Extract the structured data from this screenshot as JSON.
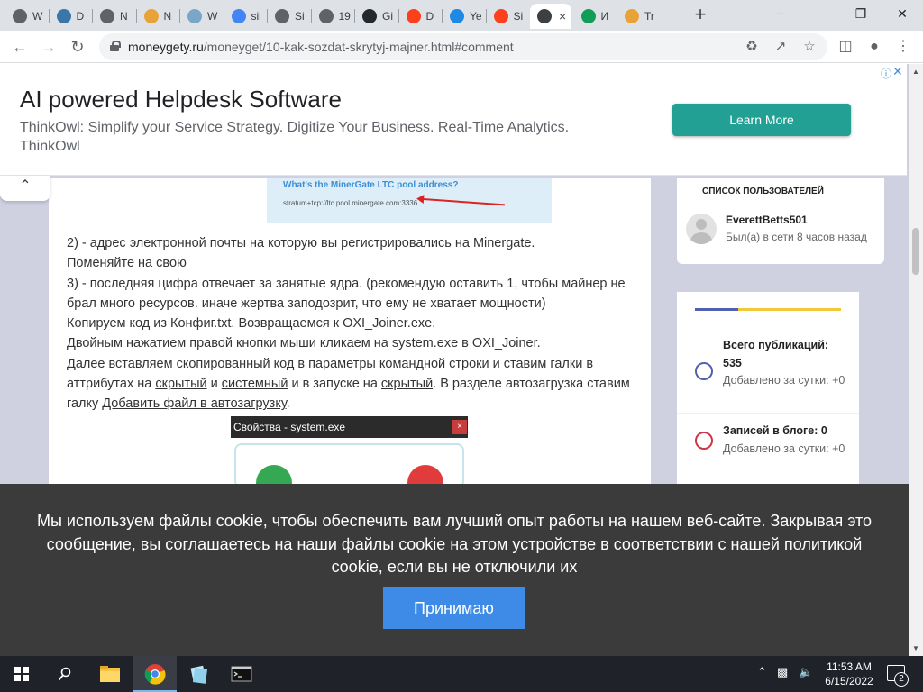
{
  "browser": {
    "tabs": [
      {
        "label": "W",
        "icon": "github-icon",
        "color": "#5f6368"
      },
      {
        "label": "D",
        "icon": "python-icon",
        "color": "#3b76a8"
      },
      {
        "label": "N",
        "icon": "github-icon",
        "color": "#5f6368"
      },
      {
        "label": "N",
        "icon": "rainbow-icon",
        "color": "#e8a23a"
      },
      {
        "label": "W",
        "icon": "web-icon",
        "color": "#7aa7c7"
      },
      {
        "label": "sil",
        "icon": "google-icon",
        "color": "#4285f4"
      },
      {
        "label": "Si",
        "icon": "globe-icon",
        "color": "#5f6368"
      },
      {
        "label": "19",
        "icon": "globe-icon",
        "color": "#5f6368"
      },
      {
        "label": "Gi",
        "icon": "github-icon",
        "color": "#24292e"
      },
      {
        "label": "D",
        "icon": "yandex-icon",
        "color": "#fc3f1d"
      },
      {
        "label": "Ye",
        "icon": "edge-icon",
        "color": "#1e88e5"
      },
      {
        "label": "Si",
        "icon": "yandex-icon",
        "color": "#fc3f1d"
      },
      {
        "label": "",
        "icon": "stack-icon",
        "color": "#3c4043",
        "active": true
      },
      {
        "label": "И",
        "icon": "drive-icon",
        "color": "#0f9d58"
      },
      {
        "label": "Tr",
        "icon": "chevron-icon",
        "color": "#e8a23a"
      }
    ],
    "url_host": "moneygety.ru",
    "url_path": "/moneyget/10-kak-sozdat-skrytyj-majner.html#comment"
  },
  "ad": {
    "title": "AI powered Helpdesk Software",
    "text": "ThinkOwl: Simplify your Service Strategy. Digitize Your Business. Real-Time Analytics. ThinkOwl",
    "button": "Learn More",
    "accent": "#23a094"
  },
  "article": {
    "image1": {
      "question": "What's the MinerGate LTC pool address?",
      "stratum": "stratum+tcp://ltc.pool.minergate.com:3336"
    },
    "lines": {
      "l1": "2) - адрес электронной почты на которую вы регистрировались на Minergate.",
      "l2": "Поменяйте на свою",
      "l3": "3) - последняя цифра отвечает за занятые ядра. (рекомендую оставить 1, чтобы майнер не брал много ресурсов. иначе жертва заподозрит, что ему не хватает мощности)",
      "l4": "Копируем код из Конфиг.txt. Возвращаемся к OXI_Joiner.exe.",
      "l5": "Двойным нажатием правой кнопки мыши кликаем на system.exe в OXI_Joiner.",
      "l6a": "Далее вставляем скопированный код в параметры командной строки и ставим галки в аттрибутах на ",
      "link_hidden1": "скрытый",
      "and": " и ",
      "link_system": "системный",
      "l6b": " и в запуске на ",
      "link_hidden2": "скрытый",
      "l6c": ". В разделе автозагрузка ставим галку ",
      "link_autostart": "Добавить файл в автозагрузку",
      "dot": "."
    },
    "image2": {
      "title": "Свойства - system.exe",
      "close": "×"
    }
  },
  "sidebar": {
    "users_title": "СПИСОК ПОЛЬЗОВАТЕЛЕЙ",
    "user_name": "EverettBetts501",
    "user_status": "Был(а) в сети 8 часов назад",
    "stats": [
      {
        "title": "Всего публикаций:",
        "value": "535",
        "sub": "Добавлено за сутки: +0",
        "color": "#5260b0"
      },
      {
        "title": "Записей в блоге:",
        "value": "0",
        "sub": "Добавлено за сутки: +0",
        "color": "#d0344a"
      }
    ]
  },
  "cookie": {
    "text": "Мы используем файлы cookie, чтобы обеспечить вам лучший опыт работы на нашем веб-сайте. Закрывая это сообщение, вы соглашаетесь на наши файлы cookie на этом устройстве в соответствии с нашей политикой cookie, если вы не отключили их",
    "button": "Принимаю",
    "accent": "#3d8be6"
  },
  "taskbar": {
    "time": "11:53 AM",
    "date": "6/15/2022",
    "notifications": "2"
  }
}
